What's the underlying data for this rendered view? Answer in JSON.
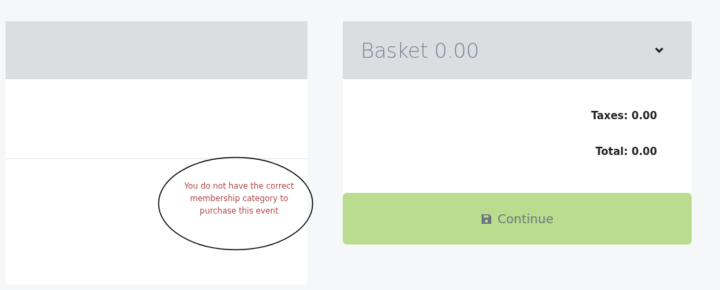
{
  "event_panel": {
    "message": "You do not have the correct membership category to purchase this event"
  },
  "basket": {
    "title": "Basket 0.00",
    "expanded": false,
    "taxes": "Taxes: 0.00",
    "total": "Total: 0.00",
    "continue_button": {
      "label": "Continue",
      "disabled": true
    }
  }
}
